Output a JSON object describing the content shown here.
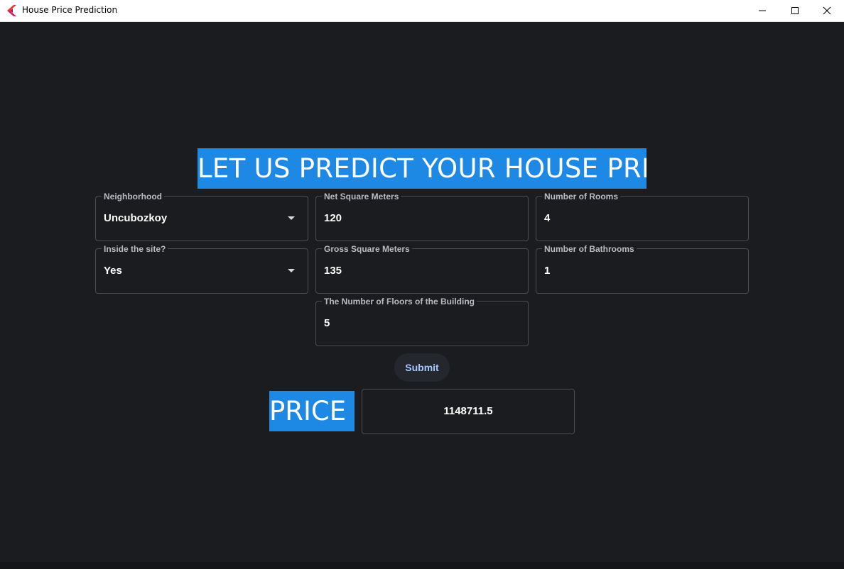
{
  "window": {
    "title": "House Price Prediction",
    "controls": [
      "minimize",
      "maximize",
      "close"
    ]
  },
  "colors": {
    "accent": "#1e88e5",
    "background": "#1b1c1f",
    "border": "#4a4d52",
    "submit_text": "#a9c7ff"
  },
  "heading": "LET US PREDICT YOUR HOUSE PRICE",
  "form": {
    "neighborhood": {
      "label": "Neighborhood",
      "value": "Uncubozkoy"
    },
    "net_sqm": {
      "label": "Net Square Meters",
      "value": "120"
    },
    "rooms": {
      "label": "Number of Rooms",
      "value": "4"
    },
    "inside_site": {
      "label": "Inside the site?",
      "value": "Yes"
    },
    "gross_sqm": {
      "label": "Gross Square Meters",
      "value": "135"
    },
    "bathrooms": {
      "label": "Number of Bathrooms",
      "value": "1"
    },
    "floors": {
      "label": "The Number of Floors of the Building",
      "value": "5"
    }
  },
  "submit_label": "Submit",
  "result": {
    "label": "PRICE :",
    "value": "1148711.5"
  }
}
